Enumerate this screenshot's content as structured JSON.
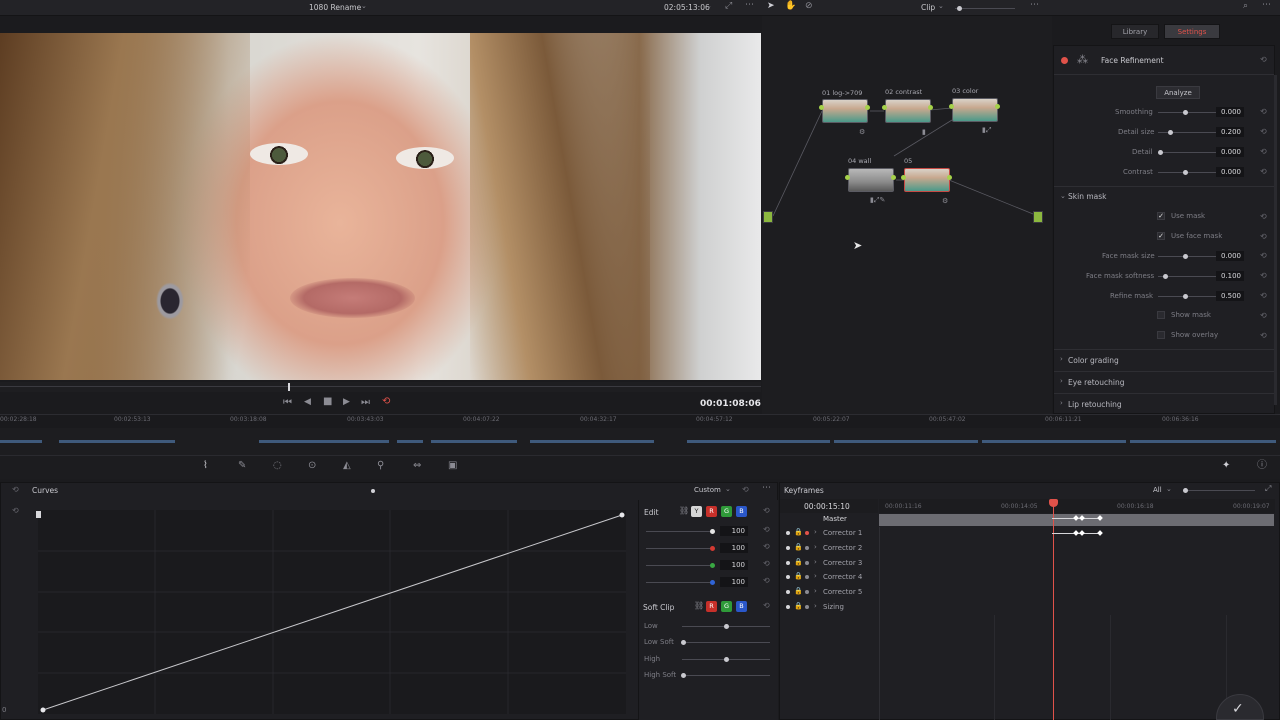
{
  "topbar": {
    "project_name": "1080 Rename",
    "timecode": "02:05:13:06",
    "clip_label": "Clip",
    "tabs": [
      "Library",
      "Settings"
    ]
  },
  "viewer": {
    "playhead_timecode": "00:01:08:06"
  },
  "ruler": {
    "ticks": [
      "00:02:28:18",
      "00:02:53:13",
      "00:03:18:08",
      "00:03:43:03",
      "00:04:07:22",
      "00:04:32:17",
      "00:04:57:12",
      "00:05:22:07",
      "00:05:47:02",
      "00:06:11:21",
      "00:06:36:16"
    ]
  },
  "nodes": [
    {
      "label": "01 log->709"
    },
    {
      "label": "02 contrast"
    },
    {
      "label": "03 color"
    },
    {
      "label": "04 wall"
    },
    {
      "label": "05"
    }
  ],
  "settings": {
    "title": "Face Refinement",
    "analyze": "Analyze",
    "params": [
      {
        "label": "Smoothing",
        "value": "0.000"
      },
      {
        "label": "Detail size",
        "value": "0.200"
      },
      {
        "label": "Detail",
        "value": "0.000"
      },
      {
        "label": "Contrast",
        "value": "0.000"
      }
    ],
    "skin_mask": {
      "title": "Skin mask",
      "use_mask": "Use mask",
      "use_face_mask": "Use face mask",
      "params": [
        {
          "label": "Face mask size",
          "value": "0.000"
        },
        {
          "label": "Face mask softness",
          "value": "0.100"
        },
        {
          "label": "Refine mask",
          "value": "0.500"
        }
      ],
      "show_mask": "Show mask",
      "show_overlay": "Show overlay"
    },
    "sections": [
      "Color grading",
      "Eye retouching",
      "Lip retouching"
    ]
  },
  "curves": {
    "title": "Curves",
    "mode": "Custom",
    "edit_label": "Edit",
    "channels": [
      "Y",
      "R",
      "G",
      "B"
    ],
    "edit_values": [
      "100",
      "100",
      "100",
      "100"
    ],
    "soft_clip_label": "Soft Clip",
    "soft_clip_channels": [
      "R",
      "G",
      "B"
    ],
    "soft_clip_rows": [
      "Low",
      "Low Soft",
      "High",
      "High Soft"
    ],
    "corner_label": "0"
  },
  "keyframes": {
    "title": "Keyframes",
    "filter": "All",
    "current_time": "00:00:15:10",
    "ticks": [
      "00:00:11:16",
      "00:00:14:05",
      "00:00:16:18",
      "00:00:19:07"
    ],
    "rows": [
      "Master",
      "Corrector 1",
      "Corrector 2",
      "Corrector 3",
      "Corrector 4",
      "Corrector 5",
      "Sizing"
    ]
  },
  "colors": {
    "accent": "#e0524a",
    "track": "#3f5a7c",
    "node_dot": "#a6d24a"
  }
}
